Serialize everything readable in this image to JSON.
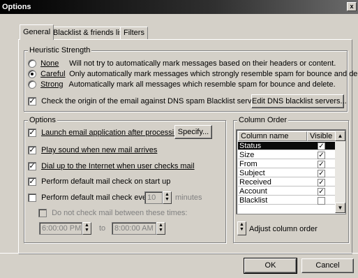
{
  "window": {
    "title": "Options",
    "close_glyph": "x"
  },
  "tabs": [
    {
      "label": "General",
      "active": true
    },
    {
      "label": "Blacklist & friends list",
      "active": false
    },
    {
      "label": "Filters",
      "active": false
    }
  ],
  "heuristic": {
    "title": "Heuristic Strength",
    "options": [
      {
        "label": "None",
        "desc": "Will not try to automatically mark messages based on their headers or content.",
        "selected": false
      },
      {
        "label": "Careful",
        "desc": "Only automatically mark messages which strongly resemble spam for bounce and delete.",
        "selected": true
      },
      {
        "label": "Strong",
        "desc": "Automatically mark all messages which resemble spam for bounce and delete.",
        "selected": false
      }
    ],
    "dns_check_label": "Check the origin of the email against DNS spam Blacklist servers",
    "dns_check_checked": true,
    "edit_dns_button": "Edit DNS blacklist servers..."
  },
  "options": {
    "title": "Options",
    "launch_label": "Launch email application after processing",
    "specify_button": "Specify...",
    "play_sound_label": "Play sound when new mail arrives",
    "dial_up_label": "Dial up to the Internet when user checks mail",
    "default_check_startup_label": "Perform default mail check on start up",
    "default_check_every_label": "Perform default mail check every",
    "interval_value": "10",
    "interval_unit": "minutes",
    "do_not_check_label": "Do not check mail between these times:",
    "time_from": "6:00:00 PM",
    "time_to_label": "to",
    "time_to": "8:00:00 AM"
  },
  "column_order": {
    "title": "Column Order",
    "header_name": "Column name",
    "header_visible": "Visible",
    "rows": [
      {
        "name": "Status",
        "visible": true,
        "selected": true
      },
      {
        "name": "Size",
        "visible": true,
        "selected": false
      },
      {
        "name": "From",
        "visible": true,
        "selected": false
      },
      {
        "name": "Subject",
        "visible": true,
        "selected": false
      },
      {
        "name": "Received",
        "visible": true,
        "selected": false
      },
      {
        "name": "Account",
        "visible": true,
        "selected": false
      },
      {
        "name": "Blacklist",
        "visible": false,
        "selected": false
      }
    ],
    "adjust_label": "Adjust column order"
  },
  "buttons": {
    "ok": "OK",
    "cancel": "Cancel"
  },
  "icons": {
    "check": "check-icon",
    "spin_up": "spin-up-icon",
    "spin_down": "spin-down-icon",
    "scroll_up": "scroll-up-icon",
    "scroll_down": "scroll-down-icon"
  }
}
